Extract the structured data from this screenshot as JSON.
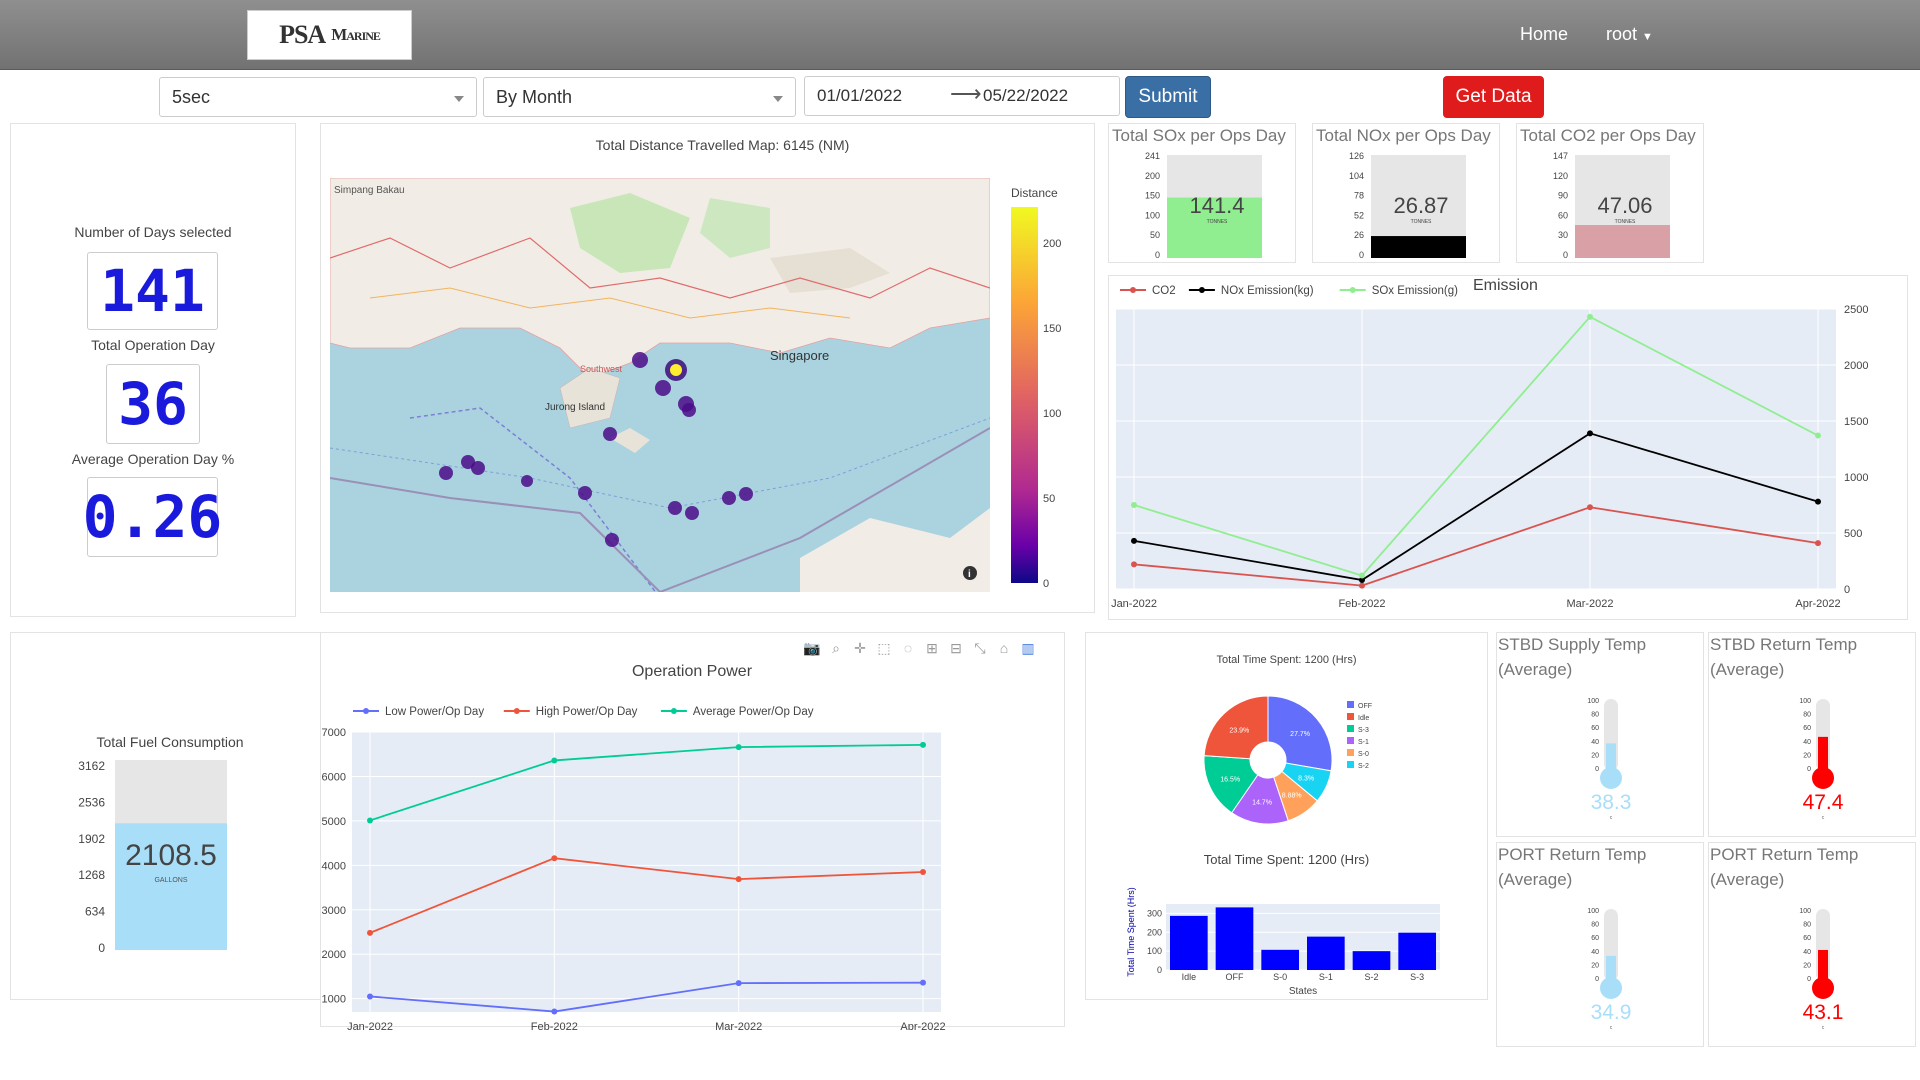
{
  "nav": {
    "logo_main": "PSA",
    "logo_sub": "Marine",
    "home": "Home",
    "user": "root"
  },
  "filters": {
    "interval": "5sec",
    "grouping": "By Month",
    "date_from": "01/01/2022",
    "date_to": "05/22/2022",
    "submit": "Submit",
    "get_data": "Get Data"
  },
  "days_panel": {
    "days_label": "Number of Days selected",
    "days_value": "141",
    "ops_label": "Total Operation Day",
    "ops_value": "36",
    "avg_label": "Average Operation Day %",
    "avg_value": "0.26"
  },
  "map": {
    "title": "Total Distance Travelled Map: 6145 (NM)",
    "colorbar_title": "Distance",
    "colorbar_ticks": [
      "200",
      "150",
      "100",
      "50",
      "0"
    ],
    "place_labels": [
      "Singapore",
      "Jurong Island",
      "Simpang Bakau",
      "Southwest"
    ]
  },
  "gauges": [
    {
      "title": "Total SOx per Ops Day",
      "value": "141.4",
      "unit": "TONNES",
      "ticks": [
        "241",
        "200",
        "150",
        "100",
        "50",
        "0"
      ],
      "fill": 0.587,
      "color": "#90ee90"
    },
    {
      "title": "Total NOx per Ops Day",
      "value": "26.87",
      "unit": "TONNES",
      "ticks": [
        "126",
        "104",
        "78",
        "52",
        "26",
        "0"
      ],
      "fill": 0.213,
      "color": "#000000"
    },
    {
      "title": "Total CO2 per Ops Day",
      "value": "47.06",
      "unit": "TONNES",
      "ticks": [
        "147",
        "120",
        "90",
        "60",
        "30",
        "0"
      ],
      "fill": 0.32,
      "color": "#d9a0a6"
    }
  ],
  "fuel": {
    "title": "Total Fuel Consumption",
    "value": "2108.5",
    "unit": "GALLONS",
    "ticks": [
      "3162",
      "2536",
      "1902",
      "1268",
      "634",
      "0"
    ],
    "fill": 0.667,
    "color": "#a9def9"
  },
  "pie": {
    "title": "Total Time Spent: 1200 (Hrs)",
    "legend": [
      "OFF",
      "Idle",
      "S-3",
      "S-1",
      "S-0",
      "S-2"
    ],
    "labels": [
      "27.7%",
      "8.3%",
      "8.88%",
      "14.7%",
      "16.5%",
      "23.9%"
    ]
  },
  "bar": {
    "title": "Total Time Spent: 1200 (Hrs)",
    "xlabel": "States",
    "ylabel": "Total Time Spent (Hrs)"
  },
  "temps": [
    {
      "title": "STBD Supply Temp (Average)",
      "value": "38.3",
      "unit": "c",
      "fill": 0.383,
      "color": "#a9def9"
    },
    {
      "title": "STBD Return Temp (Average)",
      "value": "47.4",
      "unit": "c",
      "fill": 0.474,
      "color": "#ff0000"
    },
    {
      "title": "PORT Return Temp (Average)",
      "value": "34.9",
      "unit": "c",
      "fill": 0.349,
      "color": "#a9def9"
    },
    {
      "title": "PORT Return Temp (Average)",
      "value": "43.1",
      "unit": "c",
      "fill": 0.431,
      "color": "#ff0000"
    }
  ],
  "toolbar_icons": [
    "camera-icon",
    "zoom-icon",
    "pan-icon",
    "box-select-icon",
    "lasso-icon",
    "zoom-in-icon",
    "zoom-out-icon",
    "autoscale-icon",
    "reset-axes-icon",
    "plotly-logo-icon"
  ],
  "chart_data": [
    {
      "type": "line",
      "title": "Emission",
      "categories": [
        "Jan-2022",
        "Feb-2022",
        "Mar-2022",
        "Apr-2022"
      ],
      "series": [
        {
          "name": "CO2",
          "color": "#d9534f",
          "values": [
            220,
            30,
            730,
            410
          ]
        },
        {
          "name": "NOx Emission(kg)",
          "color": "#000000",
          "values": [
            430,
            80,
            1390,
            780
          ]
        },
        {
          "name": "SOx Emission(g)",
          "color": "#90ee90",
          "values": [
            750,
            120,
            2430,
            1370
          ]
        }
      ],
      "yticks": [
        "2500",
        "2000",
        "1500",
        "1000",
        "500",
        "0"
      ],
      "ylim": [
        0,
        2500
      ]
    },
    {
      "type": "line",
      "title": "Operation Power",
      "categories": [
        "Jan-2022",
        "Feb-2022",
        "Mar-2022",
        "Apr-2022"
      ],
      "series": [
        {
          "name": "Low Power/Op Day",
          "color": "#636efa",
          "values": [
            1050,
            710,
            1350,
            1360
          ]
        },
        {
          "name": "High Power/Op Day",
          "color": "#ef553b",
          "values": [
            2480,
            4160,
            3690,
            3850
          ]
        },
        {
          "name": "Average Power/Op Day",
          "color": "#00cc96",
          "values": [
            5010,
            6360,
            6660,
            6710
          ]
        }
      ],
      "yticks": [
        "7000",
        "6000",
        "5000",
        "4000",
        "3000",
        "2000",
        "1000"
      ],
      "ylim": [
        700,
        7000
      ]
    },
    {
      "type": "pie",
      "title": "Total Time Spent: 1200 (Hrs)",
      "labels": [
        "OFF",
        "S-2",
        "S-0",
        "S-1",
        "S-3",
        "Idle"
      ],
      "values": [
        27.7,
        8.3,
        8.88,
        14.7,
        16.5,
        23.9
      ],
      "colors": [
        "#636efa",
        "#19d3f3",
        "#ffa15a",
        "#ab63fa",
        "#00cc96",
        "#ef553b"
      ]
    },
    {
      "type": "bar",
      "title": "Total Time Spent: 1200 (Hrs)",
      "categories": [
        "Idle",
        "OFF",
        "S-0",
        "S-1",
        "S-2",
        "S-3"
      ],
      "values": [
        287,
        332,
        107,
        177,
        100,
        198
      ],
      "yticks": [
        "300",
        "200",
        "100",
        "0"
      ],
      "ylim": [
        0,
        350
      ],
      "xlabel": "States",
      "ylabel": "Total Time Spent (Hrs)"
    }
  ]
}
